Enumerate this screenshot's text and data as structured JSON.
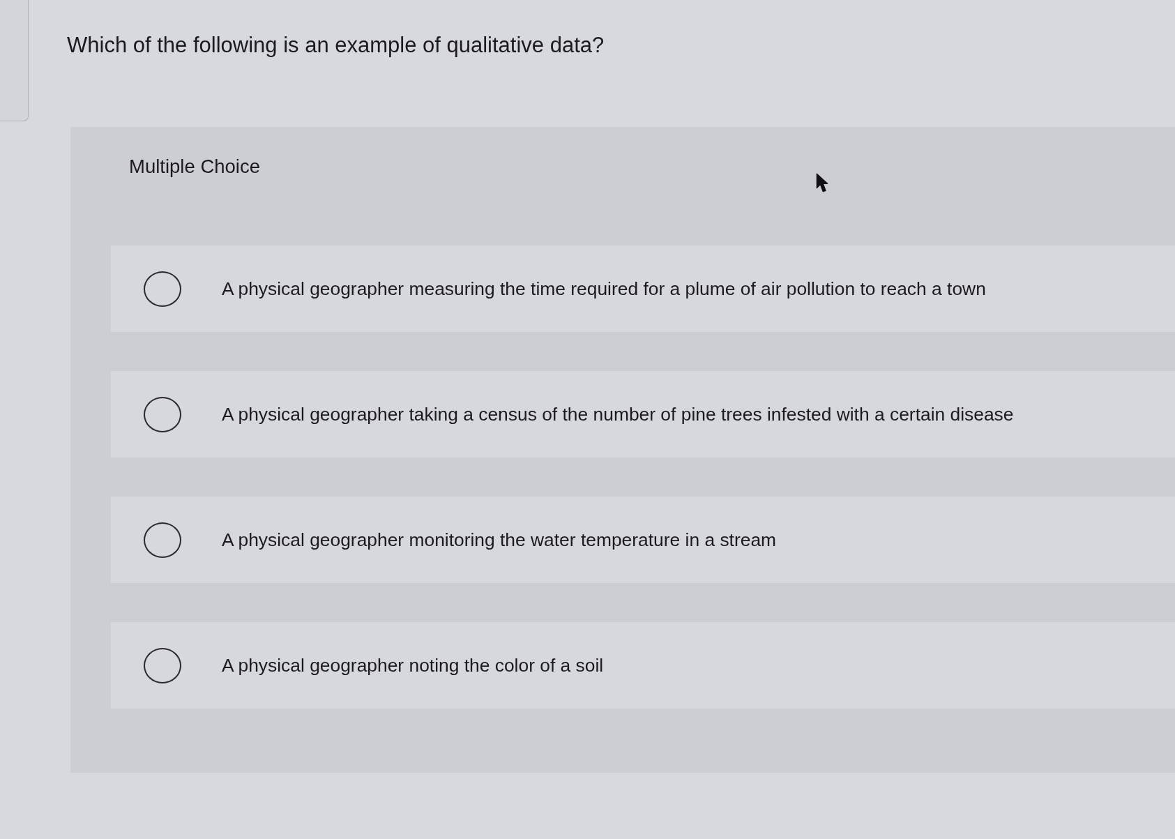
{
  "question": {
    "text": "Which of the following is an example of qualitative data?"
  },
  "answer_panel": {
    "type_label": "Multiple Choice",
    "options": [
      {
        "text": "A physical geographer measuring the time required for a plume of air pollution to reach a town",
        "selected": false
      },
      {
        "text": "A physical geographer taking a census of the number of pine trees infested with a certain disease",
        "selected": false
      },
      {
        "text": "A physical geographer monitoring the water temperature in a stream",
        "selected": false
      },
      {
        "text": "A physical geographer noting the color of a soil",
        "selected": false
      }
    ]
  }
}
